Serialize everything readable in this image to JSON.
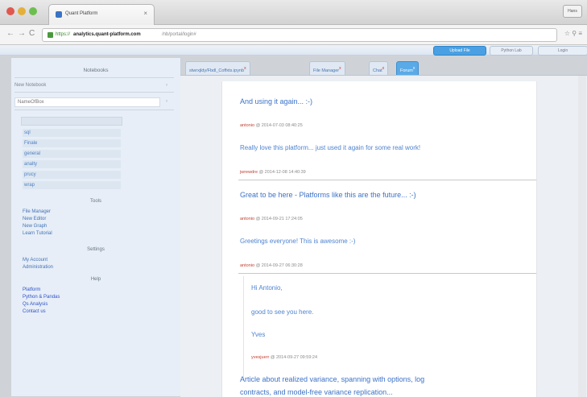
{
  "browser": {
    "tab_title": "Quant Platform",
    "tab_close": "×",
    "user_button": "Hans",
    "nav_back": "←",
    "nav_forward": "→",
    "nav_reload": "C",
    "url_scheme": "https://",
    "url_host": "analytics.quant-platform.com",
    "url_path": "/nb/portal/login#",
    "toolbar_icons": "☆ ⚲ ≡"
  },
  "app_header": {
    "upload": "Upload File",
    "other": "Python Lab",
    "login": "Login"
  },
  "sidebar": {
    "notebooks_heading": "Notebooks",
    "new_notebook": "New Notebook",
    "name_field": "NameOfBox",
    "notebooks": [
      "sql",
      "Finale",
      "general",
      "analty",
      "prucy",
      "wrap"
    ],
    "tools_heading": "Tools",
    "tools": [
      "File Manager",
      "New Editor",
      "New Graph",
      "Learn Tutorial"
    ],
    "settings_heading": "Settings",
    "settings": [
      "My Account",
      "Administration"
    ],
    "help_heading": "Help",
    "help": [
      "Platform",
      "Python & Pandas",
      "Qs Analysis",
      "Contact us"
    ]
  },
  "content_tabs": [
    {
      "label": "stwrxjldy/Fbdl_Coffxts.ipynb",
      "mark": "x"
    },
    {
      "label": "File Manager",
      "mark": "x"
    },
    {
      "label": "Chat",
      "mark": "x"
    },
    {
      "label": "Forum",
      "mark": "x"
    }
  ],
  "forum": {
    "post1_title": "And using it again... :-)",
    "post1_meta_author": "antonio",
    "post1_meta_date": "@ 2014-07-03 08:40:25",
    "post2_body": "Really love this platform... just used it again for some real work!",
    "post2_meta_author": "jwrewdre",
    "post2_meta_date": "@ 2014-12-08 14:40:39",
    "post3_title": "Great to be here - Platforms like this are the future... :-)",
    "post3_meta_author": "antonio",
    "post3_meta_date": "@ 2014-09-21 17:24:05",
    "post4_body": "Greetings everyone! This is awesome :-)",
    "post4_meta_author": "antonio",
    "post4_meta_date": "@ 2014-09-27 06:30:28",
    "reply_line1": "Hi Antonio,",
    "reply_line2": "good to see you here.",
    "reply_line3": "Yves",
    "reply_meta_author": "yvesjuerr",
    "reply_meta_date": "@ 2014-09-27 09:59:24",
    "post5_title_line1": "Article about realized variance, spanning with options, log",
    "post5_title_line2": "contracts, and model-free variance replication..."
  }
}
